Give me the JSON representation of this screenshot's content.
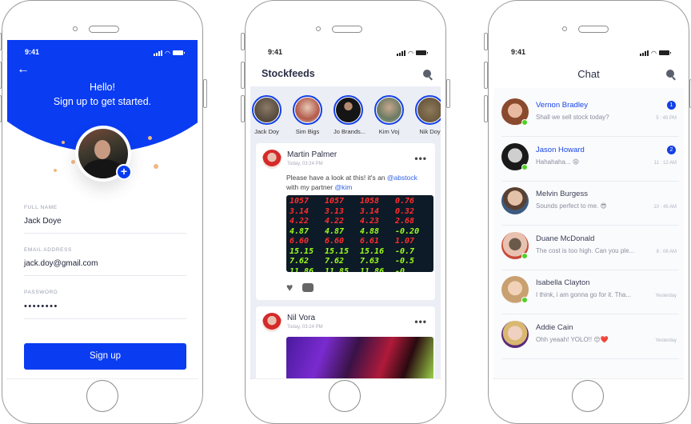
{
  "status_bar": {
    "time": "9:41"
  },
  "signup": {
    "greeting": "Hello!",
    "subtitle": "Sign up to get started.",
    "fields": [
      {
        "label": "FULL NAME",
        "value": "Jack Doye"
      },
      {
        "label": "EMAIL ADDRESS",
        "value": "jack.doy@gmail.com"
      },
      {
        "label": "PASSWORD",
        "value": "••••••••"
      }
    ],
    "submit_label": "Sign up",
    "accent": "#0a3cf2"
  },
  "stockfeeds": {
    "title": "Stockfeeds",
    "stories": [
      {
        "name": "Jack Doy"
      },
      {
        "name": "Sim Bigs"
      },
      {
        "name": "Jo Brands..."
      },
      {
        "name": "Kim Voj"
      },
      {
        "name": "Nik Doy"
      }
    ],
    "posts": [
      {
        "author": "Martin Palmer",
        "time": "Today, 03:24 PM",
        "text_before": "Please have a look at this! it's an ",
        "mention1": "@abstock",
        "text_middle": " with my partner ",
        "mention2": "@kim",
        "ticker": [
          [
            "1057",
            "1057",
            "1058",
            "0.76"
          ],
          [
            "3.14",
            "3.13",
            "3.14",
            "0.32"
          ],
          [
            "4.22",
            "4.22",
            "4.23",
            "2.68"
          ],
          [
            "4.87",
            "4.87",
            "4.88",
            "-0.20"
          ],
          [
            "6.60",
            "6.60",
            "6.61",
            "1.07"
          ],
          [
            "15.15",
            "15.15",
            "15.16",
            "-0.7"
          ],
          [
            "7.62",
            "7.62",
            "7.63",
            "-0.5"
          ],
          [
            "11.86",
            "11.85",
            "11.86",
            "-0"
          ]
        ]
      },
      {
        "author": "Nil Vora",
        "time": "Today, 03:24 PM"
      }
    ]
  },
  "chat": {
    "title": "Chat",
    "conversations": [
      {
        "name": "Vernon Bradley",
        "message": "Shall we sell stock today?",
        "time": "5 : 45 PM",
        "unread": "1",
        "online": true
      },
      {
        "name": "Jason Howard",
        "message": "Hahahaha... 😩",
        "time": "11 : 12 AM",
        "unread": "2",
        "online": true
      },
      {
        "name": "Melvin Burgess",
        "message": "Sounds perfect to me. 😎",
        "time": "10 : 45 AM",
        "unread": null,
        "online": false
      },
      {
        "name": "Duane McDonald",
        "message": "The cost is too high. Can you ple...",
        "time": "8 : 06 AM",
        "unread": null,
        "online": true
      },
      {
        "name": "Isabella Clayton",
        "message": "I think, i am gonna go for it. Tha...",
        "time": "Yesterday",
        "unread": null,
        "online": true
      },
      {
        "name": "Addie Cain",
        "message": "Ohh yeaah! YOLO!! 😍❤️",
        "time": "Yesterday",
        "unread": null,
        "online": false
      }
    ]
  }
}
